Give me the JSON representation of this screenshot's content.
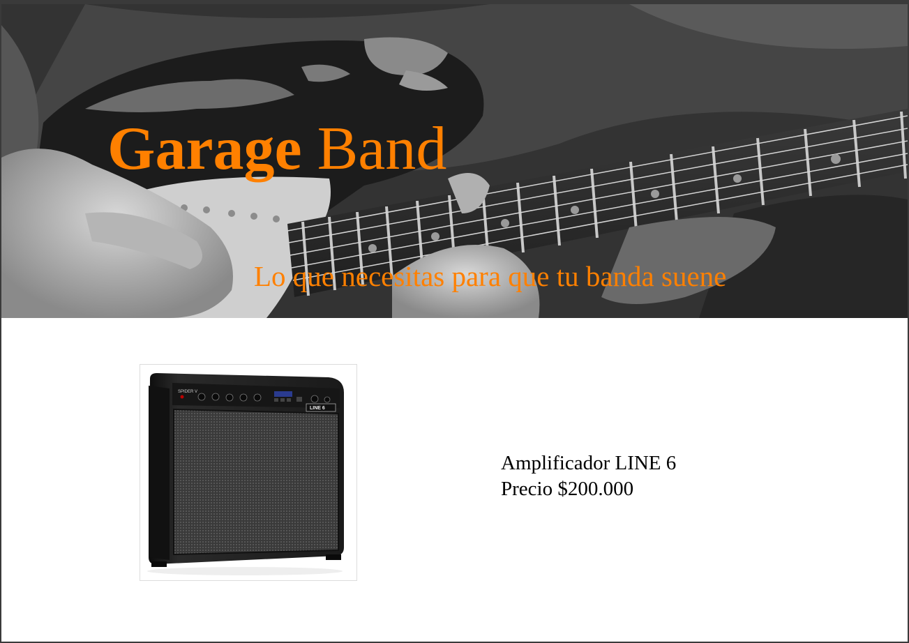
{
  "hero": {
    "title_bold": "Garage",
    "title_rest": " Band",
    "tagline": "Lo que necesitas para que tu banda suene",
    "accent_color": "#ff8000",
    "background_image": "black-and-white photo of guitarist playing electric guitar"
  },
  "product": {
    "image": "guitar-amplifier-photo",
    "name": "Amplificador LINE 6",
    "price": "Precio $200.000",
    "amp_panel_text": "SPIDER V",
    "amp_brand_text": "LINE 6"
  }
}
